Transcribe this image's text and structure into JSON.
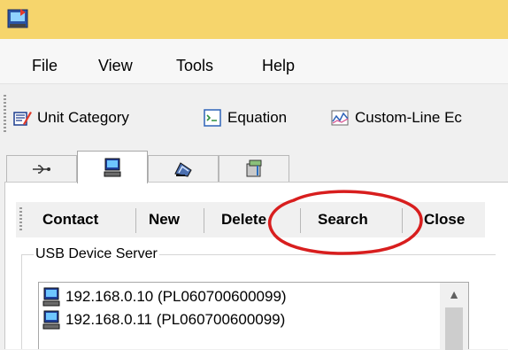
{
  "menu": [
    "File",
    "View",
    "Tools",
    "Help"
  ],
  "toolbar": [
    {
      "label": "Unit Category",
      "icon": "unit-category-icon"
    },
    {
      "label": "Equation",
      "icon": "equation-icon"
    },
    {
      "label": "Custom-Line Ec",
      "icon": "custom-line-icon"
    }
  ],
  "tabs": [
    {
      "icon": "usb-icon"
    },
    {
      "icon": "computer-icon",
      "active": true
    },
    {
      "icon": "modem-icon"
    },
    {
      "icon": "device-icon"
    }
  ],
  "actions": [
    "Contact",
    "New",
    "Delete",
    "Search",
    "Close"
  ],
  "group_title": "USB Device Server",
  "devices": [
    "192.168.0.10 (PL060700600099)",
    "192.168.0.11 (PL060700600099)"
  ],
  "annotation": {
    "target": "Search",
    "color": "#d81e1e"
  }
}
